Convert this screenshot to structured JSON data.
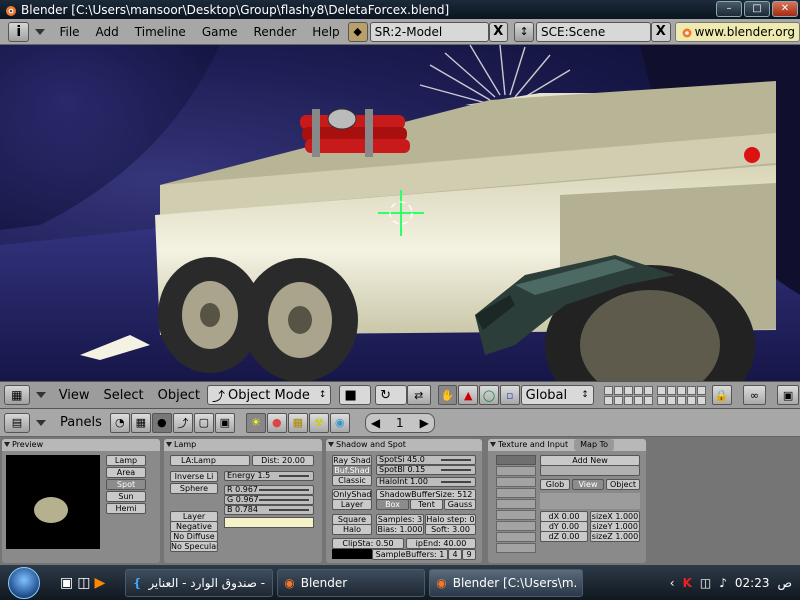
{
  "window": {
    "title": "Blender [C:\\Users\\mansoor\\Desktop\\Group\\flashy8\\DeletaForcex.blend]"
  },
  "top_menu": {
    "items": [
      "File",
      "Add",
      "Timeline",
      "Game",
      "Render",
      "Help"
    ],
    "screen": "SR:2-Model",
    "scene": "SCE:Scene",
    "url": "www.blender.org"
  },
  "viewport_header": {
    "menus": [
      "View",
      "Select",
      "Object"
    ],
    "mode": "Object Mode",
    "orientation": "Global"
  },
  "buttons_header": {
    "label": "Panels",
    "frame": "1"
  },
  "panels": {
    "preview": {
      "title": "Preview",
      "types": [
        "Lamp",
        "Area",
        "Spot",
        "Sun",
        "Hemi"
      ],
      "selected": "Spot"
    },
    "lamp": {
      "title": "Lamp",
      "name": "LA:Lamp",
      "dist": "Dist: 20.00",
      "inverse": "Inverse Li",
      "sphere": "Sphere",
      "energy": "Energy 1.5",
      "r": "R 0.967",
      "g": "G 0.967",
      "b": "B 0.784",
      "toggles": [
        "Layer",
        "Negative",
        "No Diffuse",
        "No Specular"
      ]
    },
    "shadow": {
      "title": "Shadow and Spot",
      "ray": "Ray Shad",
      "buf": "Buf.Shad",
      "classic": "Classic",
      "spotsi": "SpotSi 45.0",
      "spotbl": "SpotBl 0.15",
      "haloint": "HaloInt 1.00",
      "onlyshad": "OnlyShad",
      "layer": "Layer",
      "bufsize": "ShadowBufferSize: 512",
      "buftypes": [
        "Box",
        "Tent",
        "Gauss"
      ],
      "square": "Square",
      "halo": "Halo",
      "samples": "Samples: 3",
      "halostep": "Halo step: 0",
      "bias": "Bias: 1.000",
      "soft": "Soft: 3.00",
      "clipsta": "ClipSta: 0.50",
      "clipend": "ipEnd: 40.00",
      "samplebuffers": "SampleBuffers: 1",
      "sb2": "4",
      "sb3": "9"
    },
    "texture": {
      "title": "Texture and Input",
      "tab": "Map To",
      "add_new": "Add New",
      "coords": [
        "Glob",
        "View",
        "Object"
      ],
      "dx": "dX 0.00",
      "dy": "dY 0.00",
      "dz": "dZ 0.00",
      "sx": "sizeX 1.000",
      "sy": "sizeY 1.000",
      "sz": "sizeZ 1.000"
    }
  },
  "taskbar": {
    "tasks": [
      "صندوق الوارد - العناير - ...",
      "Blender",
      "Blender [C:\\Users\\m..."
    ],
    "time": "02:23",
    "ampm": "ص"
  },
  "colors": {
    "menu_bg": "#a7a7a7",
    "panel_bg": "#757575",
    "cursor": "#2dff6a",
    "taskbar": "#1a2430"
  }
}
